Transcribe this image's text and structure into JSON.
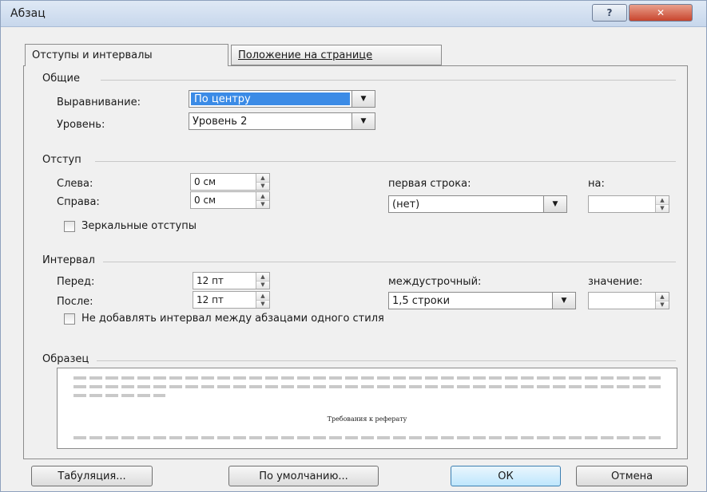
{
  "window": {
    "title": "Абзац",
    "help_label": "?",
    "close_label": "✕"
  },
  "tabs": [
    {
      "label": "Отступы и интервалы"
    },
    {
      "label": "Положение на странице"
    }
  ],
  "general": {
    "section_title": "Общие",
    "alignment_label": "Выравнивание:",
    "alignment_value": "По центру",
    "level_label": "Уровень:",
    "level_value": "Уровень 2"
  },
  "indent": {
    "section_title": "Отступ",
    "left_label": "Слева:",
    "left_value": "0 см",
    "right_label": "Справа:",
    "right_value": "0 см",
    "first_line_label": "первая строка:",
    "first_line_value": "(нет)",
    "by_label": "на:",
    "by_value": "",
    "mirror_label": "Зеркальные отступы"
  },
  "spacing": {
    "section_title": "Интервал",
    "before_label": "Перед:",
    "before_value": "12 пт",
    "after_label": "После:",
    "after_value": "12 пт",
    "line_spacing_label": "междустрочный:",
    "line_spacing_value": "1,5 строки",
    "value_label": "значение:",
    "value_value": "",
    "no_space_label": "Не добавлять интервал между абзацами одного стиля"
  },
  "preview": {
    "section_title": "Образец",
    "sample_text": "Требования к реферату"
  },
  "buttons": {
    "tabs": "Табуляция...",
    "default": "По умолчанию...",
    "ok": "ОК",
    "cancel": "Отмена"
  }
}
